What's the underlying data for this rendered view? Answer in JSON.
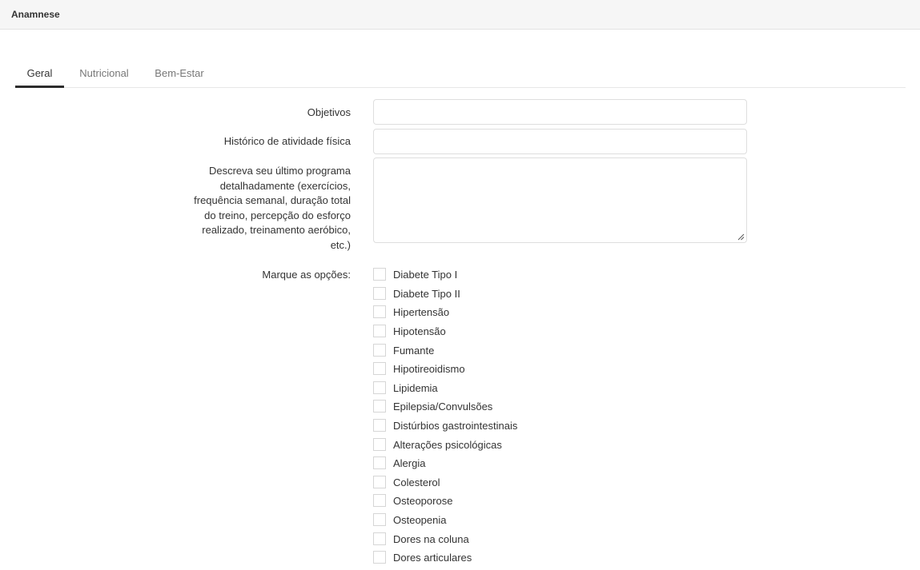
{
  "panel": {
    "title": "Anamnese"
  },
  "tabs": [
    {
      "label": "Geral",
      "active": true
    },
    {
      "label": "Nutricional",
      "active": false
    },
    {
      "label": "Bem-Estar",
      "active": false
    }
  ],
  "form": {
    "objetivos": {
      "label": "Objetivos",
      "value": ""
    },
    "historico": {
      "label": "Histórico de atividade física",
      "value": ""
    },
    "descricao": {
      "label_lines": [
        "Descreva seu último programa",
        "detalhadamente (exercícios,",
        "frequência semanal, duração total",
        "do treino, percepção do esforço",
        "realizado, treinamento aeróbico,",
        "etc.)"
      ],
      "value": ""
    },
    "opcoes": {
      "label": "Marque as opções:",
      "items": [
        {
          "label": "Diabete Tipo I",
          "checked": false
        },
        {
          "label": "Diabete Tipo II",
          "checked": false
        },
        {
          "label": "Hipertensão",
          "checked": false
        },
        {
          "label": "Hipotensão",
          "checked": false
        },
        {
          "label": "Fumante",
          "checked": false
        },
        {
          "label": "Hipotireoidismo",
          "checked": false
        },
        {
          "label": "Lipidemia",
          "checked": false
        },
        {
          "label": "Epilepsia/Convulsões",
          "checked": false
        },
        {
          "label": "Distúrbios gastrointestinais",
          "checked": false
        },
        {
          "label": "Alterações psicológicas",
          "checked": false
        },
        {
          "label": "Alergia",
          "checked": false
        },
        {
          "label": "Colesterol",
          "checked": false
        },
        {
          "label": "Osteoporose",
          "checked": false
        },
        {
          "label": "Osteopenia",
          "checked": false
        },
        {
          "label": "Dores na coluna",
          "checked": false
        },
        {
          "label": "Dores articulares",
          "checked": false
        }
      ]
    }
  },
  "colors": {
    "tab_active_underline": "#2c2c2c",
    "border": "#dedede",
    "header_bg": "#f6f6f6"
  }
}
